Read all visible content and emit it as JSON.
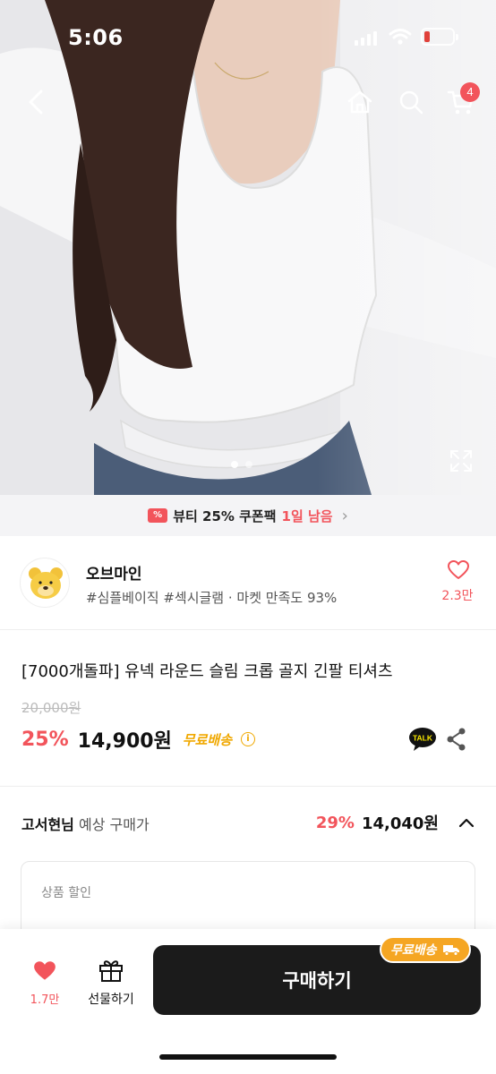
{
  "status_bar": {
    "time": "5:06"
  },
  "nav": {
    "cart_count": "4"
  },
  "coupon_banner": {
    "text1": "뷰티 25% 쿠폰팩",
    "text2": "1일 남음"
  },
  "store": {
    "name": "오브마인",
    "tags": "#심플베이직 #섹시글램 · 마켓 만족도 93%",
    "likes": "2.3만"
  },
  "product": {
    "title": "[7000개돌파] 유넥 라운드 슬림 크롭 골지 긴팔 티셔츠",
    "original_price": "20,000원",
    "discount": "25%",
    "price": "14,900원",
    "shipping": "무료배송",
    "talk_label": "TALK"
  },
  "expected": {
    "user": "고서현님",
    "label": " 예상 구매가",
    "discount": "29%",
    "price": "14,040원",
    "discount_section": "상품 할인"
  },
  "bottom_bar": {
    "likes": "1.7만",
    "gift_label": "선물하기",
    "buy_label": "구매하기",
    "free_badge": "무료배송"
  },
  "colors": {
    "accent": "#f2545b",
    "shipping": "#f0a800",
    "buy_button": "#1b1b1b"
  }
}
